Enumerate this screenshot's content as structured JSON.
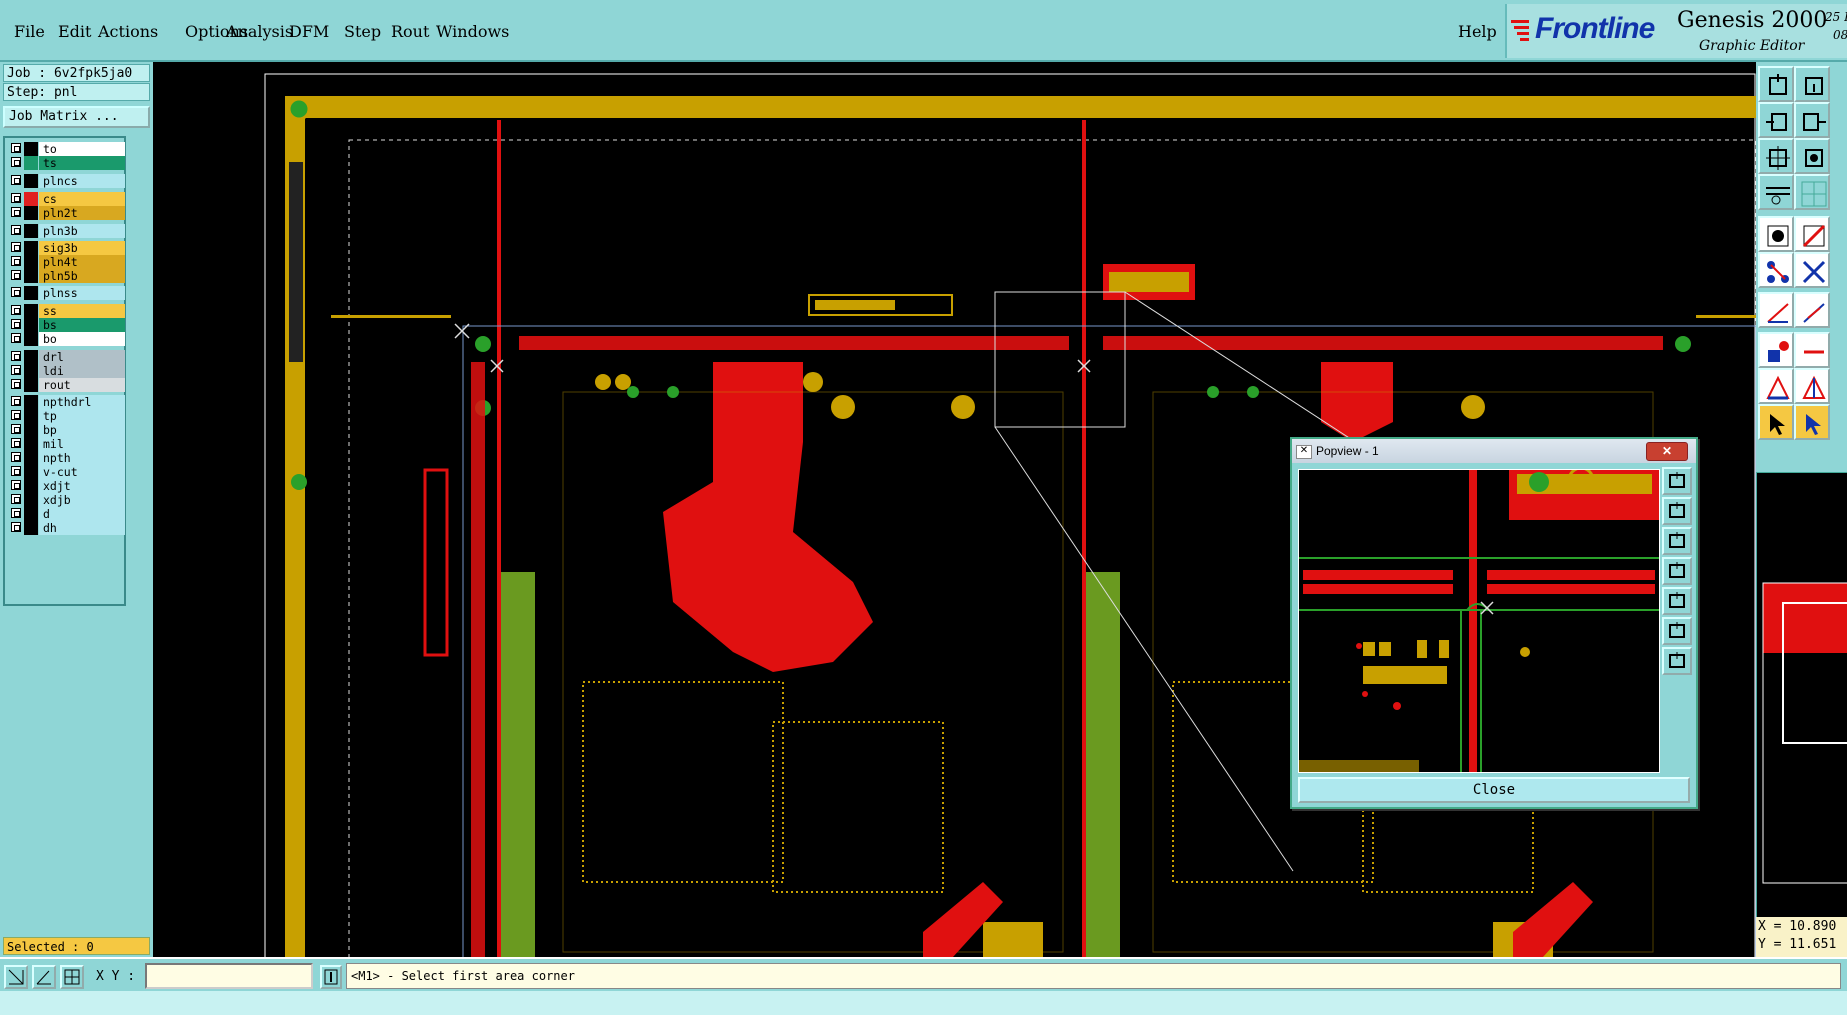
{
  "menu": {
    "items": [
      "File",
      "Edit",
      "Actions",
      "Options",
      "Analysis",
      "DFM",
      "Step",
      "Rout",
      "Windows"
    ],
    "help": "Help"
  },
  "brand": {
    "logo": "Frontline",
    "product": "Genesis 2000",
    "subtitle": "Graphic Editor",
    "date_line1": "25 I",
    "date_line2": "08"
  },
  "job": {
    "job_label": "Job : 6v2fpk5ja0",
    "step_label": "Step: pnl",
    "matrix_button": "Job Matrix ..."
  },
  "layers": [
    {
      "name": "to",
      "color": "#ffffff",
      "swatch": "#000000"
    },
    {
      "name": "ts",
      "color": "#1a9a6c",
      "swatch": "#1a9a6c"
    },
    {
      "name": "plncs",
      "color": "#aee6ee",
      "swatch": "#000000"
    },
    {
      "name": "cs",
      "color": "#f5c842",
      "swatch": "#e02020"
    },
    {
      "name": "pln2t",
      "color": "#d8a820",
      "swatch": "#000000"
    },
    {
      "name": "pln3b",
      "color": "#aee6ee",
      "swatch": "#000000"
    },
    {
      "name": "sig3b",
      "color": "#f5c842",
      "swatch": "#000000"
    },
    {
      "name": "pln4t",
      "color": "#d8a820",
      "swatch": "#000000"
    },
    {
      "name": "pln5b",
      "color": "#d8a820",
      "swatch": "#000000"
    },
    {
      "name": "plnss",
      "color": "#aee6ee",
      "swatch": "#000000"
    },
    {
      "name": "ss",
      "color": "#f5c842",
      "swatch": "#000000"
    },
    {
      "name": "bs",
      "color": "#1a9a6c",
      "swatch": "#000000"
    },
    {
      "name": "bo",
      "color": "#ffffff",
      "swatch": "#000000"
    },
    {
      "name": "drl",
      "color": "#b0c0c8",
      "swatch": "#000000"
    },
    {
      "name": "ldi",
      "color": "#b0c0c8",
      "swatch": "#000000"
    },
    {
      "name": "rout",
      "color": "#d8dde0",
      "swatch": "#000000"
    },
    {
      "name": "npthdrl",
      "color": "#aee6ee",
      "swatch": "#000000"
    },
    {
      "name": "tp",
      "color": "#aee6ee",
      "swatch": "#000000"
    },
    {
      "name": "bp",
      "color": "#aee6ee",
      "swatch": "#000000"
    },
    {
      "name": "mil",
      "color": "#aee6ee",
      "swatch": "#000000"
    },
    {
      "name": "npth",
      "color": "#aee6ee",
      "swatch": "#000000"
    },
    {
      "name": "v-cut",
      "color": "#aee6ee",
      "swatch": "#000000"
    },
    {
      "name": "xdjt",
      "color": "#aee6ee",
      "swatch": "#000000"
    },
    {
      "name": "xdjb",
      "color": "#aee6ee",
      "swatch": "#000000"
    },
    {
      "name": "d",
      "color": "#aee6ee",
      "swatch": "#000000"
    },
    {
      "name": "dh",
      "color": "#aee6ee",
      "swatch": "#000000"
    }
  ],
  "status": {
    "selected": "Selected : 0",
    "xy_label": "X Y :",
    "prompt": "<M1> - Select first area corner"
  },
  "coords": {
    "x": "X = 10.890",
    "y": "Y = 11.651"
  },
  "popview": {
    "title": "Popview - 1",
    "close_button": "Close"
  },
  "colors": {
    "board_gold": "#c8a000",
    "copper_red": "#e01010",
    "panel_cyan": "#8fd6d6",
    "green_pad": "#2aa02a"
  }
}
